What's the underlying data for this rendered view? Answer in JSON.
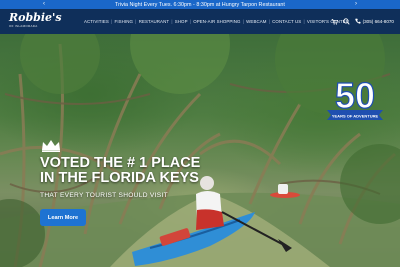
{
  "announcement": {
    "text": "Trivia Night Every Tues. 6:30pm - 8:30pm at Hungry Tarpon Restaurant",
    "prev_icon": "chevron-left-icon",
    "next_icon": "chevron-right-icon"
  },
  "header": {
    "logo_script": "Robbie's",
    "logo_sub": "OF ISLAMORADA",
    "nav": [
      {
        "label": "ACTIVITIES"
      },
      {
        "label": "FISHING"
      },
      {
        "label": "RESTAURANT"
      },
      {
        "label": "SHOP"
      },
      {
        "label": "OPEN-AIR SHOPPING"
      },
      {
        "label": "WEBCAM"
      },
      {
        "label": "CONTACT US"
      },
      {
        "label": "VISITOR'S CENTER"
      }
    ],
    "cart_icon": "cart-icon",
    "search_icon": "search-icon",
    "phone_icon": "phone-icon",
    "phone": "(305) 664-8070"
  },
  "hero": {
    "badge": {
      "number": "50",
      "text": "YEARS OF ADVENTURE"
    },
    "crown_icon": "crown-icon",
    "headline_line1": "VOTED THE # 1 PLACE",
    "headline_line2": "IN THE FLORIDA KEYS",
    "tagline": "THAT EVERY TOURIST SHOULD VISIT",
    "button_label": "Learn More"
  },
  "colors": {
    "announce_bg": "#1a67c9",
    "nav_bg": "#0f2f5a",
    "button_bg": "#1e73d2",
    "badge_blue": "#1f4fb0"
  }
}
